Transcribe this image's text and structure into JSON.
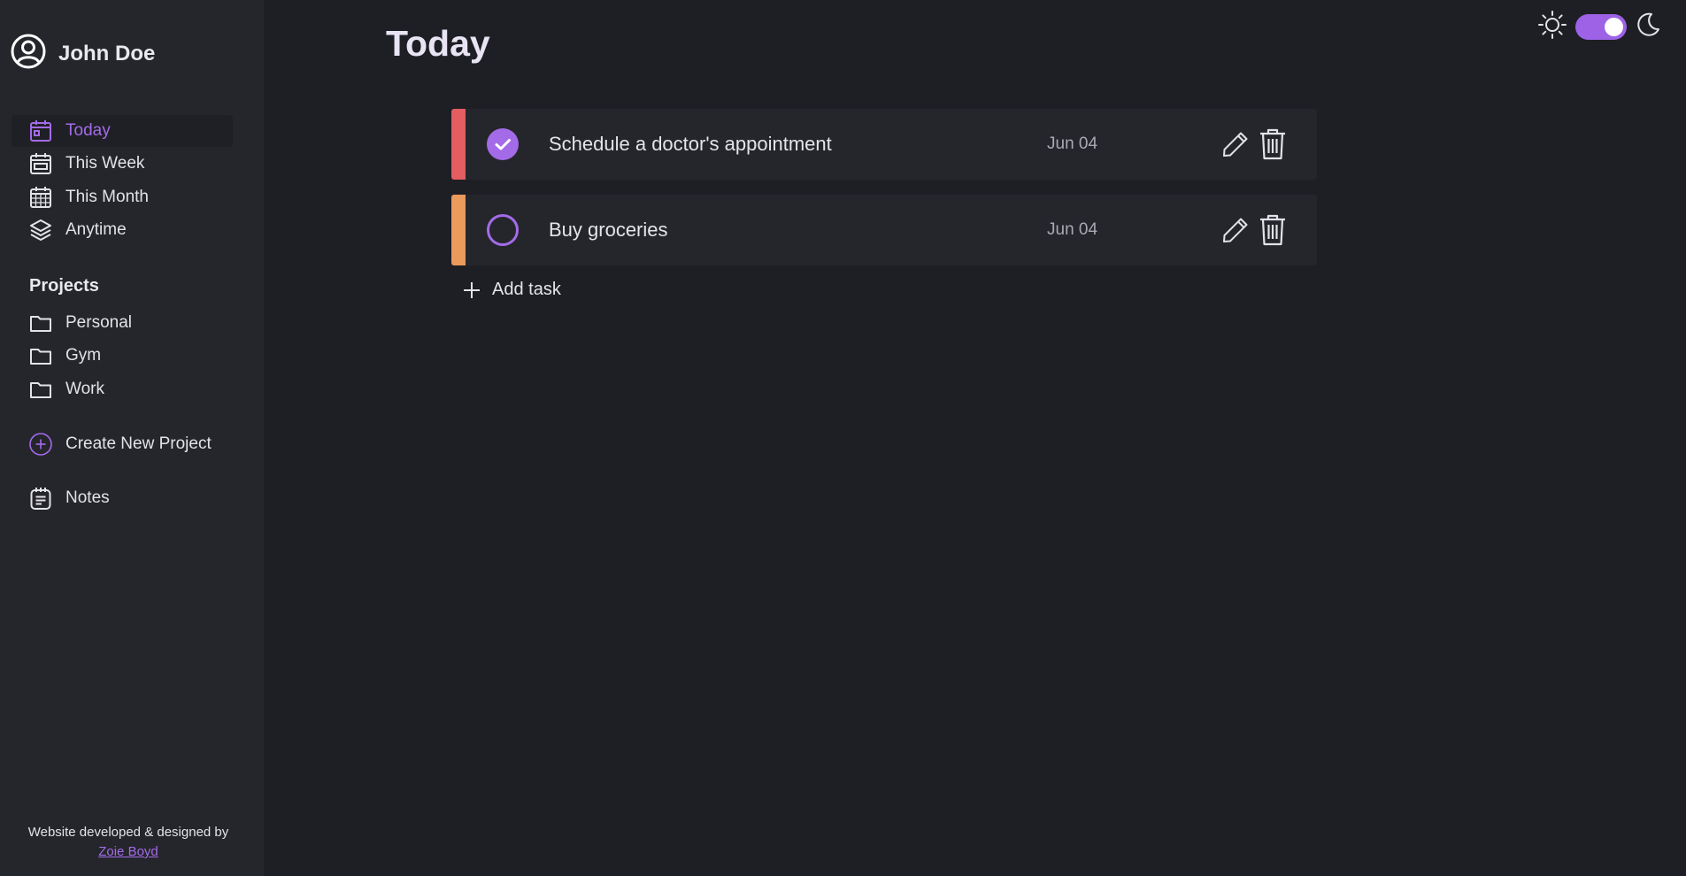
{
  "user": {
    "name": "John Doe"
  },
  "nav": {
    "items": [
      {
        "label": "Today",
        "icon": "calendar-day-icon",
        "active": true
      },
      {
        "label": "This Week",
        "icon": "calendar-week-icon",
        "active": false
      },
      {
        "label": "This Month",
        "icon": "calendar-month-icon",
        "active": false
      },
      {
        "label": "Anytime",
        "icon": "layers-icon",
        "active": false
      }
    ]
  },
  "projects": {
    "title": "Projects",
    "items": [
      {
        "label": "Personal",
        "icon": "folder-icon"
      },
      {
        "label": "Gym",
        "icon": "folder-icon"
      },
      {
        "label": "Work",
        "icon": "folder-icon"
      }
    ],
    "create_label": "Create New Project"
  },
  "notes": {
    "label": "Notes"
  },
  "footer": {
    "text": "Website developed & designed by",
    "link": "Zoie Boyd"
  },
  "page": {
    "title": "Today"
  },
  "theme": {
    "mode": "dark",
    "accent": "#a36be8"
  },
  "tasks": [
    {
      "title": "Schedule a doctor's appointment",
      "date": "Jun 04",
      "completed": true,
      "priority_color": "#e35d61"
    },
    {
      "title": "Buy groceries",
      "date": "Jun 04",
      "completed": false,
      "priority_color": "#e99a5c"
    }
  ],
  "add_task": {
    "label": "Add task"
  }
}
